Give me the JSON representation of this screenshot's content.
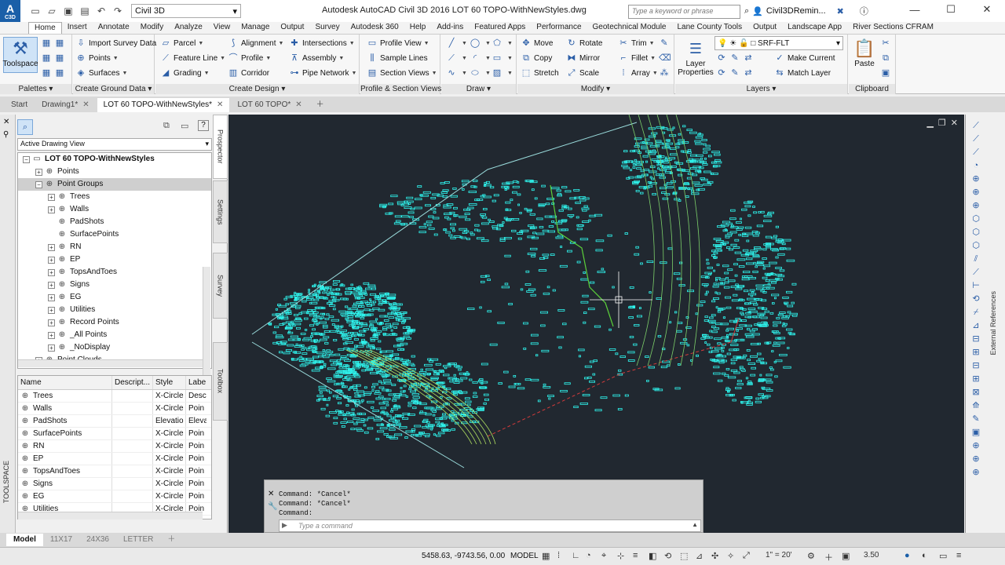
{
  "app": {
    "logo_text": "A",
    "logo_sub": "C3D",
    "title": "Autodesk AutoCAD Civil 3D 2016    LOT 60 TOPO-WithNewStyles.dwg",
    "workspace": "Civil 3D",
    "search_placeholder": "Type a keyword or phrase",
    "user": "Civil3DRemin..."
  },
  "ribbon_tabs": [
    "Home",
    "Insert",
    "Annotate",
    "Modify",
    "Analyze",
    "View",
    "Manage",
    "Output",
    "Survey",
    "Autodesk 360",
    "Help",
    "Add-ins",
    "Featured Apps",
    "Performance",
    "Geotechnical Module",
    "Lane County Tools",
    "Output",
    "Landscape App",
    "River Sections CFRAM"
  ],
  "panels": {
    "palettes": {
      "title": "Palettes",
      "toolspace": "Toolspace"
    },
    "ground": {
      "title": "Create Ground Data",
      "import": "Import Survey Data",
      "points": "Points",
      "surfaces": "Surfaces"
    },
    "design": {
      "title": "Create Design",
      "parcel": "Parcel",
      "feature_line": "Feature Line",
      "grading": "Grading",
      "alignment": "Alignment",
      "profile": "Profile",
      "corridor": "Corridor",
      "intersections": "Intersections",
      "assembly": "Assembly",
      "pipe_network": "Pipe Network"
    },
    "profile_section": {
      "title": "Profile & Section Views",
      "profile_view": "Profile View",
      "sample_lines": "Sample Lines",
      "section_views": "Section Views"
    },
    "draw": {
      "title": "Draw"
    },
    "modify": {
      "title": "Modify",
      "move": "Move",
      "copy": "Copy",
      "stretch": "Stretch",
      "rotate": "Rotate",
      "mirror": "Mirror",
      "scale": "Scale",
      "trim": "Trim",
      "fillet": "Fillet",
      "array": "Array"
    },
    "layers": {
      "title": "Layers",
      "layer_properties": "Layer Properties",
      "current_layer": "SRF-FLT",
      "make_current": "Make Current",
      "match_layer": "Match Layer"
    },
    "clipboard": {
      "title": "Clipboard",
      "paste": "Paste"
    }
  },
  "doc_tabs": [
    {
      "label": "Start"
    },
    {
      "label": "Drawing1*"
    },
    {
      "label": "LOT 60 TOPO-WithNewStyles*"
    },
    {
      "label": "LOT 60 TOPO*"
    }
  ],
  "toolspace": {
    "strip_label": "TOOLSPACE",
    "view": "Active Drawing View",
    "vtabs": [
      "Prospector",
      "Settings",
      "Survey",
      "Toolbox"
    ],
    "tree": [
      {
        "label": "LOT 60 TOPO-WithNewStyles",
        "level": 0,
        "bold": true
      },
      {
        "label": "Points",
        "level": 1
      },
      {
        "label": "Point Groups",
        "level": 1,
        "selected": true
      },
      {
        "label": "Trees",
        "level": 2
      },
      {
        "label": "Walls",
        "level": 2
      },
      {
        "label": "PadShots",
        "level": 2
      },
      {
        "label": "SurfacePoints",
        "level": 2
      },
      {
        "label": "RN",
        "level": 2
      },
      {
        "label": "EP",
        "level": 2
      },
      {
        "label": "TopsAndToes",
        "level": 2
      },
      {
        "label": "Signs",
        "level": 2
      },
      {
        "label": "EG",
        "level": 2
      },
      {
        "label": "Utilities",
        "level": 2
      },
      {
        "label": "Record Points",
        "level": 2
      },
      {
        "label": "_All Points",
        "level": 2
      },
      {
        "label": "_NoDisplay",
        "level": 2
      },
      {
        "label": "Point Clouds",
        "level": 1
      }
    ],
    "list_headers": [
      "Name",
      "Descript...",
      "Style",
      "Labe"
    ],
    "list_rows": [
      [
        "Trees",
        "",
        "X-Circle",
        "Desc"
      ],
      [
        "Walls",
        "",
        "X-Circle",
        "Poin"
      ],
      [
        "PadShots",
        "",
        "Elevatio",
        "Eleva"
      ],
      [
        "SurfacePoints",
        "",
        "X-Circle",
        "Poin"
      ],
      [
        "RN",
        "",
        "X-Circle",
        "Poin"
      ],
      [
        "EP",
        "",
        "X-Circle",
        "Poin"
      ],
      [
        "TopsAndToes",
        "",
        "X-Circle",
        "Poin"
      ],
      [
        "Signs",
        "",
        "X-Circle",
        "Poin"
      ],
      [
        "EG",
        "",
        "X-Circle",
        "Poin"
      ],
      [
        "Utilities",
        "",
        "X-Circle",
        "Poin"
      ]
    ]
  },
  "right_bar": {
    "label": "External References"
  },
  "command": {
    "history": [
      "Command: *Cancel*",
      "Command: *Cancel*",
      "Command:"
    ],
    "placeholder": "Type a command"
  },
  "layout_tabs": [
    "Model",
    "11X17",
    "24X36",
    "LETTER"
  ],
  "status": {
    "coords": "5458.63, -9743.56, 0.00",
    "space": "MODEL",
    "scale": "1\" = 20'",
    "zoom": "3.50"
  }
}
